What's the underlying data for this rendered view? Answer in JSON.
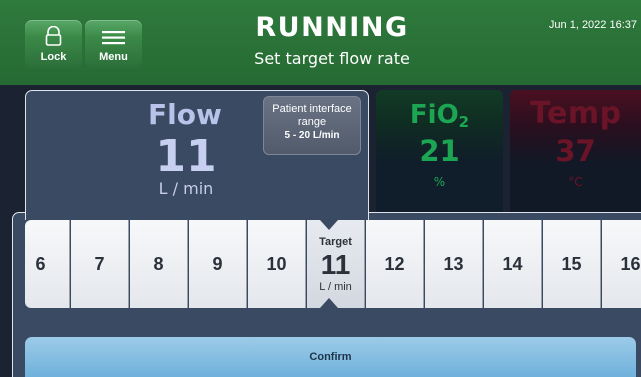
{
  "header": {
    "lock_label": "Lock",
    "menu_label": "Menu",
    "status": "RUNNING",
    "subtitle": "Set target flow rate",
    "datetime": "Jun 1, 2022 16:37"
  },
  "flow": {
    "title": "Flow",
    "value": "11",
    "unit": "L / min",
    "interface_range": {
      "line1": "Patient interface",
      "line2": "range",
      "line3": "5 - 20 L/min"
    }
  },
  "fio2": {
    "title": "FiO",
    "title_sub": "2",
    "value": "21",
    "unit": "%"
  },
  "temp": {
    "title": "Temp",
    "value": "37",
    "unit": "°C"
  },
  "selector": {
    "values": [
      "6",
      "7",
      "8",
      "9",
      "10",
      "11",
      "12",
      "13",
      "14",
      "15",
      "16"
    ],
    "selected_index": 5,
    "target_label": "Target",
    "target_unit": "L / min"
  },
  "confirm_label": "Confirm",
  "colors": {
    "header_green": "#2f7a3d",
    "fio2_green": "#1ca653",
    "temp_red": "#6b1427",
    "confirm_blue": "#7fbce2"
  }
}
